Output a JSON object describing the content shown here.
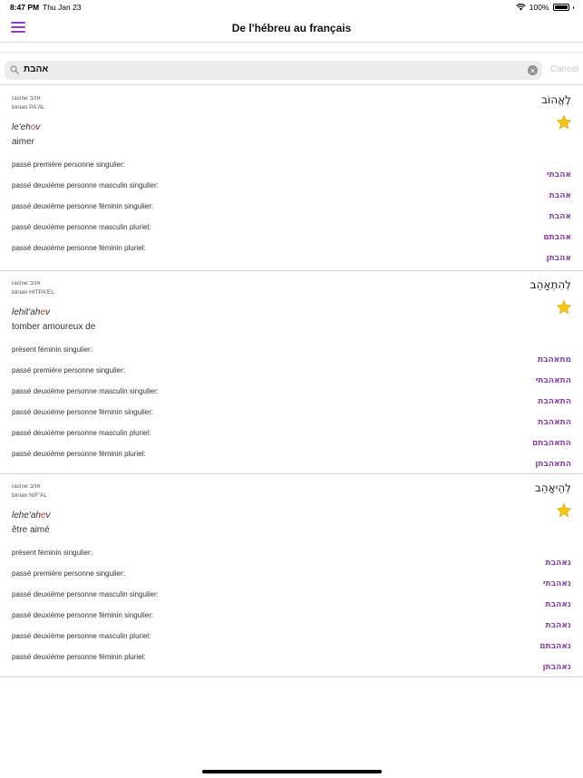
{
  "status_bar": {
    "time": "8:47 PM",
    "date": "Thu Jan 23",
    "battery": "100%"
  },
  "nav": {
    "title": "De l'hébreu au français"
  },
  "search": {
    "value": "אהבת",
    "cancel_label": "Cancel"
  },
  "colors": {
    "accent": "#8e3ec9",
    "form_purple": "#8e44ad",
    "star": "#f5c518"
  },
  "entries": [
    {
      "root": "racine אהב",
      "binian": "binian PA'AL",
      "headword": "לֶאֱהוֹב",
      "translit_pre": "le'eh",
      "translit_stress": "o",
      "translit_post": "v",
      "meaning": "aimer",
      "forms": [
        {
          "label": "passé première personne singulier:",
          "value": "אהבתי"
        },
        {
          "label": "passé deuxième personne masculin singulier:",
          "value": "אהבת"
        },
        {
          "label": "passé deuxième personne féminin singulier:",
          "value": "אהבת"
        },
        {
          "label": "passé deuxième personne masculin pluriel:",
          "value": "אהבתם"
        },
        {
          "label": "passé deuxième personne féminin pluriel:",
          "value": "אהבתן"
        }
      ]
    },
    {
      "root": "racine אהב",
      "binian": "binian HITPA'EL",
      "headword": "לְהִתְאַהֵב",
      "translit_pre": "lehit'ah",
      "translit_stress": "e",
      "translit_post": "v",
      "meaning": "tomber amoureux de",
      "forms": [
        {
          "label": "présent féminin singulier:",
          "value": "מתאהבת"
        },
        {
          "label": "passé première personne singulier:",
          "value": "התאהבתי"
        },
        {
          "label": "passé deuxième personne masculin singulier:",
          "value": "התאהבת"
        },
        {
          "label": "passé deuxième personne féminin singulier:",
          "value": "התאהבת"
        },
        {
          "label": "passé deuxième personne masculin pluriel:",
          "value": "התאהבתם"
        },
        {
          "label": "passé deuxième personne féminin pluriel:",
          "value": "התאהבתן"
        }
      ]
    },
    {
      "root": "racine אהב",
      "binian": "binian NIF'AL",
      "headword": "לְהֵיאָהֵב",
      "translit_pre": "lehe'ah",
      "translit_stress": "e",
      "translit_post": "v",
      "meaning": "être aimé",
      "forms": [
        {
          "label": "présent féminin singulier:",
          "value": "נאהבת"
        },
        {
          "label": "passé première personne singulier:",
          "value": "נאהבתי"
        },
        {
          "label": "passé deuxième personne masculin singulier:",
          "value": "נאהבת"
        },
        {
          "label": "passé deuxième personne féminin singulier:",
          "value": "נאהבת"
        },
        {
          "label": "passé deuxième personne masculin pluriel:",
          "value": "נאהבתם"
        },
        {
          "label": "passé deuxième personne féminin pluriel:",
          "value": "נאהבתן"
        }
      ]
    }
  ]
}
